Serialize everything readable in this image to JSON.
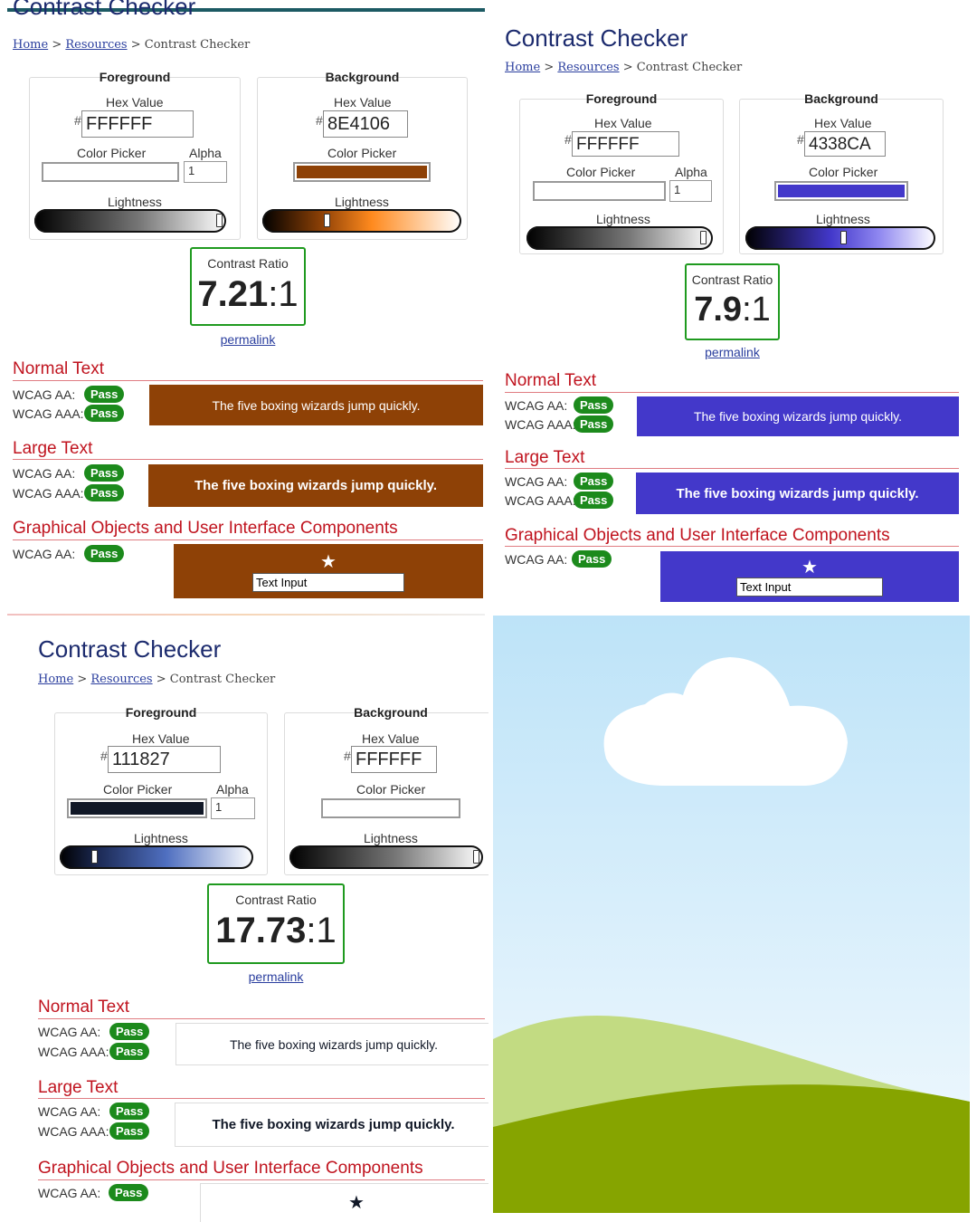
{
  "panels": [
    {
      "title": "Contrast Checker",
      "breadcrumb": {
        "home": "Home",
        "sep1": ">",
        "resources": "Resources",
        "sep2": ">",
        "current": "Contrast Checker"
      },
      "foreground": {
        "heading": "Foreground",
        "hex_label": "Hex Value",
        "hash": "#",
        "hex": "FFFFFF",
        "picker_label": "Color Picker",
        "alpha_label": "Alpha",
        "alpha": "1",
        "lightness_label": "Lightness",
        "color": "#FFFFFF",
        "lightness": 1.0
      },
      "background": {
        "heading": "Background",
        "hex_label": "Hex Value",
        "hash": "#",
        "hex": "8E4106",
        "picker_label": "Color Picker",
        "lightness_label": "Lightness",
        "color": "#8E4106",
        "lightness": 0.3
      },
      "contrast": {
        "label": "Contrast Ratio",
        "value": "7.21",
        "suffix": ":1"
      },
      "permalink": "permalink",
      "normal_text": {
        "title": "Normal Text",
        "aa": "WCAG AA:",
        "aa_status": "Pass",
        "aaa": "WCAG AAA:",
        "aaa_status": "Pass",
        "sample": "The five boxing wizards jump quickly."
      },
      "large_text": {
        "title": "Large Text",
        "aa": "WCAG AA:",
        "aa_status": "Pass",
        "aaa": "WCAG AAA:",
        "aaa_status": "Pass",
        "sample": "The five boxing wizards jump quickly."
      },
      "graphical": {
        "title": "Graphical Objects and User Interface Components",
        "aa": "WCAG AA:",
        "aa_status": "Pass",
        "star": "★",
        "text_input": "Text Input"
      }
    },
    {
      "title": "Contrast Checker",
      "breadcrumb": {
        "home": "Home",
        "sep1": ">",
        "resources": "Resources",
        "sep2": ">",
        "current": "Contrast Checker"
      },
      "foreground": {
        "heading": "Foreground",
        "hex_label": "Hex Value",
        "hash": "#",
        "hex": "FFFFFF",
        "picker_label": "Color Picker",
        "alpha_label": "Alpha",
        "alpha": "1",
        "lightness_label": "Lightness",
        "color": "#FFFFFF",
        "lightness": 1.0
      },
      "background": {
        "heading": "Background",
        "hex_label": "Hex Value",
        "hash": "#",
        "hex": "4338CA",
        "picker_label": "Color Picker",
        "lightness_label": "Lightness",
        "color": "#4338CA",
        "lightness": 0.5
      },
      "contrast": {
        "label": "Contrast Ratio",
        "value": "7.9",
        "suffix": ":1"
      },
      "permalink": "permalink",
      "normal_text": {
        "title": "Normal Text",
        "aa": "WCAG AA:",
        "aa_status": "Pass",
        "aaa": "WCAG AAA:",
        "aaa_status": "Pass",
        "sample": "The five boxing wizards jump quickly."
      },
      "large_text": {
        "title": "Large Text",
        "aa": "WCAG AA:",
        "aa_status": "Pass",
        "aaa": "WCAG AAA:",
        "aaa_status": "Pass",
        "sample": "The five boxing wizards jump quickly."
      },
      "graphical": {
        "title": "Graphical Objects and User Interface Components",
        "aa": "WCAG AA:",
        "aa_status": "Pass",
        "star": "★",
        "text_input": "Text Input"
      }
    },
    {
      "title": "Contrast Checker",
      "breadcrumb": {
        "home": "Home",
        "sep1": ">",
        "resources": "Resources",
        "sep2": ">",
        "current": "Contrast Checker"
      },
      "foreground": {
        "heading": "Foreground",
        "hex_label": "Hex Value",
        "hash": "#",
        "hex": "111827",
        "picker_label": "Color Picker",
        "alpha_label": "Alpha",
        "alpha": "1",
        "lightness_label": "Lightness",
        "color": "#111827",
        "lightness": 0.15
      },
      "background": {
        "heading": "Background",
        "hex_label": "Hex Value",
        "hash": "#",
        "hex": "FFFFFF",
        "picker_label": "Color Picker",
        "lightness_label": "Lightness",
        "color": "#FFFFFF",
        "lightness": 1.0
      },
      "contrast": {
        "label": "Contrast Ratio",
        "value": "17.73",
        "suffix": ":1"
      },
      "permalink": "permalink",
      "normal_text": {
        "title": "Normal Text",
        "aa": "WCAG AA:",
        "aa_status": "Pass",
        "aaa": "WCAG AAA:",
        "aaa_status": "Pass",
        "sample": "The five boxing wizards jump quickly."
      },
      "large_text": {
        "title": "Large Text",
        "aa": "WCAG AA:",
        "aa_status": "Pass",
        "aaa": "WCAG AAA:",
        "aaa_status": "Pass",
        "sample": "The five boxing wizards jump quickly."
      },
      "graphical": {
        "title": "Graphical Objects and User Interface Components",
        "aa": "WCAG AA:",
        "aa_status": "Pass",
        "star": "★"
      }
    }
  ],
  "scene": {
    "sky_top": "#BDE3F8",
    "sky_bottom": "#F4FAFE",
    "cloud": "#FFFFFF",
    "hill_light": "#C2DB82",
    "hill_dark": "#86A400"
  },
  "colors": {
    "title": "#1C2B6E",
    "section": "#C0141F",
    "pass": "#1C8A1C",
    "link": "#2A3E9E",
    "ratio_border": "#1F9A1F"
  }
}
